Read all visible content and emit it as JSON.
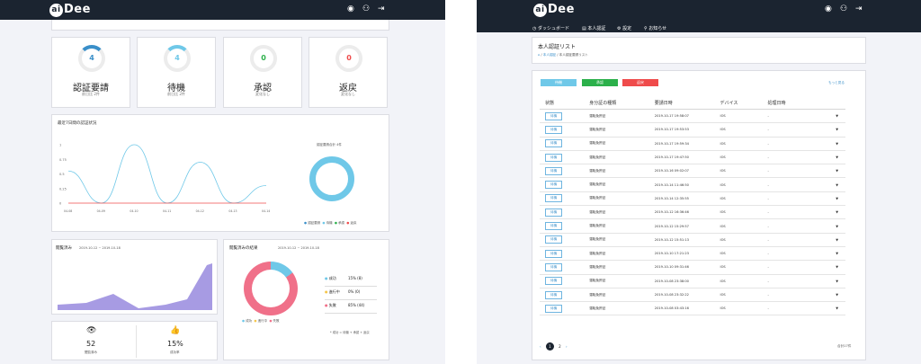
{
  "brand": "Dee",
  "brand_ai": "ai",
  "left": {
    "stats": [
      {
        "value": "4",
        "label": "認証要請",
        "sub": "前日比 2件",
        "color": "#3a8fc9"
      },
      {
        "value": "4",
        "label": "待機",
        "sub": "前日比 2件",
        "color": "#6fc8e8"
      },
      {
        "value": "0",
        "label": "承認",
        "sub": "変化なし",
        "color": "#2bb04a"
      },
      {
        "value": "0",
        "label": "返戻",
        "sub": "変化なし",
        "color": "#ef4b4b"
      }
    ],
    "line_chart_title": "最近7日間の認証状況",
    "y_ticks": [
      "1",
      "0.75",
      "0.5",
      "0.25",
      "0"
    ],
    "x_ticks": [
      "04-08",
      "04-09",
      "04-10",
      "04-11",
      "04-12",
      "04-13",
      "04-14"
    ],
    "donut_label": "認証要請合計 4件",
    "legend": [
      "認証要請",
      "待機",
      "承認",
      "返戻"
    ],
    "chart_data": {
      "type": "line",
      "y_ticks": [
        "1",
        "0.75",
        "0.5",
        "0.25",
        "0"
      ],
      "ylim": [
        0,
        1
      ],
      "series": [
        {
          "name": "待機",
          "values": [
            0.55,
            0,
            1,
            0,
            0.7,
            0,
            0.3
          ]
        },
        {
          "name": "返戻",
          "values": [
            0,
            0,
            0,
            0,
            0,
            0,
            0
          ]
        }
      ]
    },
    "views_title": "閲覧済み",
    "views_range": "2019-10-12 ~ 2019-10-18",
    "result_title": "閲覧済みの結果",
    "result_range": "2019-10-12 ~ 2019-10-18",
    "result_rows": [
      {
        "label": "成功",
        "value": "15% (8)",
        "color": "#6fc8e8"
      },
      {
        "label": "進行中",
        "value": "0% (0)",
        "color": "#f5c64a"
      },
      {
        "label": "失敗",
        "value": "85% (44)",
        "color": "#f07089"
      }
    ],
    "result_legend": [
      "成功",
      "進行中",
      "失敗"
    ],
    "result_note": "* 成功 = 待機 + 承認 + 返戻",
    "views_count": "52",
    "views_count_label": "閲覧済み",
    "rate": "15%",
    "rate_label": "成功率"
  },
  "right": {
    "nav": [
      "ダッシュボード",
      "本人認証",
      "設定",
      "お知らせ"
    ],
    "page_title": "本人認証リスト",
    "breadcrumb": [
      "本人認証",
      "本人認証要請リスト"
    ],
    "tabs": [
      {
        "label": "待機",
        "color": "#6fc8e8"
      },
      {
        "label": "承認",
        "color": "#2bb04a"
      },
      {
        "label": "返戻",
        "color": "#ef4b4b"
      }
    ],
    "more_link": "もっと見る",
    "columns": [
      "状態",
      "身分証の種類",
      "要請日時",
      "デバイス",
      "処理日時"
    ],
    "rows": [
      {
        "status": "待機",
        "doc": "運転免許証",
        "date": "2019-10-17 19:58:07",
        "device": "IOS",
        "processed": "-"
      },
      {
        "status": "待機",
        "doc": "運転免許証",
        "date": "2019-10-17 19:53:53",
        "device": "IOS",
        "processed": "-"
      },
      {
        "status": "待機",
        "doc": "運転免許証",
        "date": "2019-10-17 19:59:34",
        "device": "IOS",
        "processed": "-"
      },
      {
        "status": "待機",
        "doc": "運転免許証",
        "date": "2019-10-17 19:47:50",
        "device": "IOS",
        "processed": "-"
      },
      {
        "status": "待機",
        "doc": "運転免許証",
        "date": "2019-10-16 09:02:07",
        "device": "IOS",
        "processed": "-"
      },
      {
        "status": "待機",
        "doc": "運転免許証",
        "date": "2019-10-14 11:46:50",
        "device": "IOS",
        "processed": "-"
      },
      {
        "status": "待機",
        "doc": "運転免許証",
        "date": "2019-10-14 12:35:55",
        "device": "IOS",
        "processed": "-"
      },
      {
        "status": "待機",
        "doc": "運転免許証",
        "date": "2019-10-12 16:36:46",
        "device": "IOS",
        "processed": "-"
      },
      {
        "status": "待機",
        "doc": "運転免許証",
        "date": "2019-10-12 15:29:57",
        "device": "IOS",
        "processed": "-"
      },
      {
        "status": "待機",
        "doc": "運転免許証",
        "date": "2019-10-12 15:51:13",
        "device": "IOS",
        "processed": "-"
      },
      {
        "status": "待機",
        "doc": "運転免許証",
        "date": "2019-10-10 17:21:23",
        "device": "IOS",
        "processed": "-"
      },
      {
        "status": "待機",
        "doc": "運転免許証",
        "date": "2019-10-10 09:31:46",
        "device": "IOS",
        "processed": "-"
      },
      {
        "status": "待機",
        "doc": "運転免許証",
        "date": "2019-10-08 23:38:00",
        "device": "IOS",
        "processed": "-"
      },
      {
        "status": "待機",
        "doc": "運転免許証",
        "date": "2019-10-08 23:32:22",
        "device": "IOS",
        "processed": "-"
      },
      {
        "status": "待機",
        "doc": "運転免許証",
        "date": "2019-10-08 03:43:16",
        "device": "IOS",
        "processed": "-"
      }
    ],
    "pages": [
      "1",
      "2"
    ],
    "total": "合計17件"
  }
}
